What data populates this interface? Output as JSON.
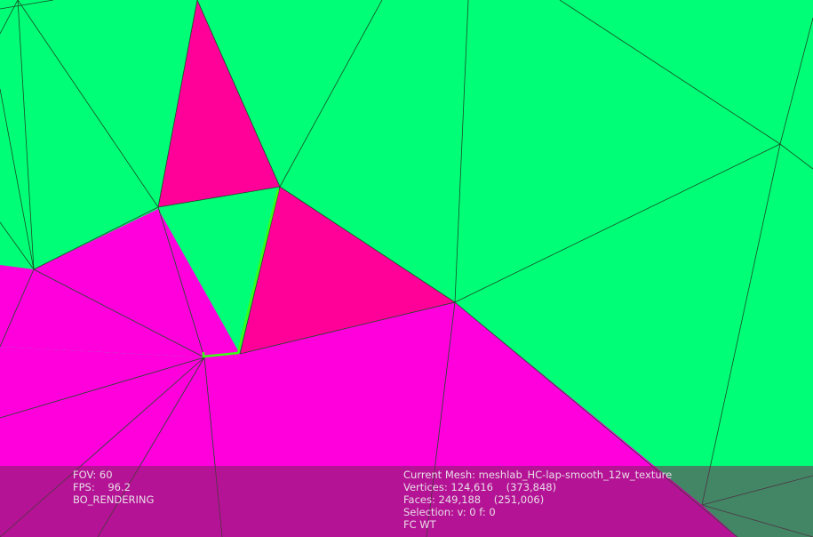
{
  "viewer": {
    "colors": {
      "face_green": "#00ff76",
      "face_magenta": "#ff00dd",
      "face_selected": "#ff0099",
      "edge": "#1a4a26",
      "selection_border": "#39ff14",
      "overlay_bg": "#78235a",
      "overlay_text": "#e8dde8"
    },
    "left_info": {
      "fov": "FOV: 60",
      "fps": "FPS:    96.2",
      "render_mode": "BO_RENDERING"
    },
    "right_info": {
      "current_mesh": "Current Mesh: meshlab_HC-lap-smooth_12w_texture",
      "vertices": "Vertices: 124,616    (373,848)",
      "faces": "Faces: 249,188    (251,006)",
      "selection": "Selection: v: 0 f: 0",
      "flags": "FC WT"
    }
  }
}
